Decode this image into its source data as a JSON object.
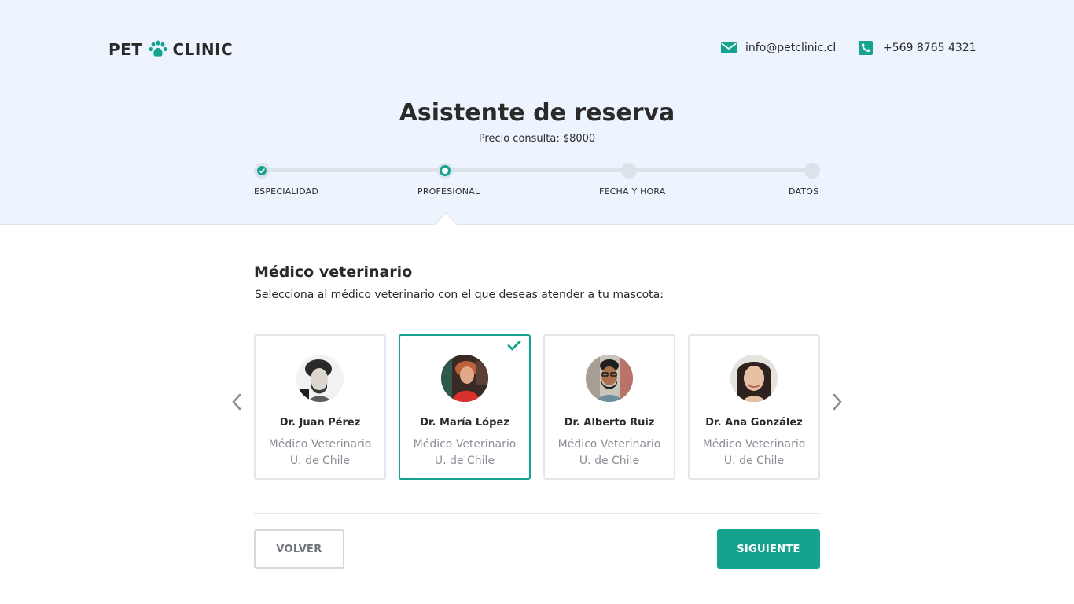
{
  "header": {
    "logo_left": "PET",
    "logo_right": "CLINIC",
    "email": "info@petclinic.cl",
    "phone": "+569 8765 4321"
  },
  "hero": {
    "title": "Asistente de reserva",
    "price": "Precio consulta: $8000"
  },
  "steps": [
    {
      "label": "ESPECIALIDAD",
      "state": "done"
    },
    {
      "label": "PROFESIONAL",
      "state": "active"
    },
    {
      "label": "FECHA Y HORA",
      "state": "pending"
    },
    {
      "label": "DATOS",
      "state": "pending"
    }
  ],
  "section": {
    "title": "Médico veterinario",
    "subtitle": "Selecciona al médico veterinario con el que deseas atender a tu mascota:"
  },
  "vets": [
    {
      "name": "Dr. Juan Pérez",
      "role": "Médico Veterinario",
      "university": "U. de Chile",
      "selected": false
    },
    {
      "name": "Dr. María López",
      "role": "Médico Veterinario",
      "university": "U. de Chile",
      "selected": true
    },
    {
      "name": "Dr. Alberto Ruiz",
      "role": "Médico Veterinario",
      "university": "U. de Chile",
      "selected": false
    },
    {
      "name": "Dr. Ana González",
      "role": "Médico Veterinario",
      "university": "U. de Chile",
      "selected": false
    }
  ],
  "buttons": {
    "back": "VOLVER",
    "next": "SIGUIENTE"
  },
  "icons": {
    "logo": "paw-icon",
    "email": "envelope-icon",
    "phone": "phone-icon",
    "prev": "chevron-left-icon",
    "next": "chevron-right-icon",
    "selected": "check-icon"
  },
  "colors": {
    "accent": "#13a38e",
    "hero_bg": "#edf4fd",
    "text": "#2a2a2a",
    "muted": "#8a8f96"
  }
}
